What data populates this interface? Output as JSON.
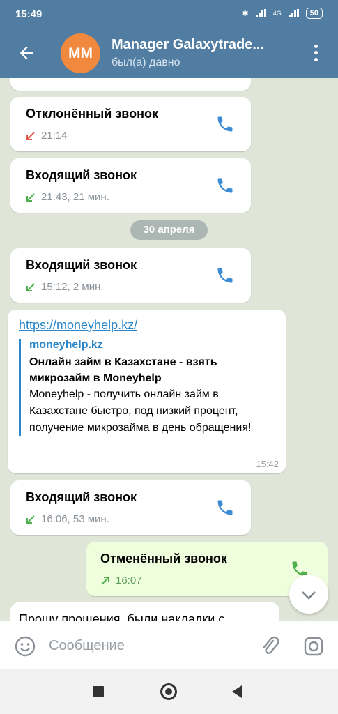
{
  "status_bar": {
    "time": "15:49",
    "battery": "50",
    "network": "4G"
  },
  "header": {
    "avatar_initials": "MM",
    "title": "Manager Galaxytrade...",
    "subtitle": "был(а) давно",
    "accent_color": "#517da2",
    "avatar_color": "#f0883d"
  },
  "messages": [
    {
      "type": "call",
      "title": "Отклонённый звонок",
      "meta": "21:14",
      "direction": "declined"
    },
    {
      "type": "call",
      "title": "Входящий звонок",
      "meta": "21:43, 21 мин.",
      "direction": "incoming"
    },
    {
      "type": "date",
      "label": "30 апреля"
    },
    {
      "type": "call",
      "title": "Входящий звонок",
      "meta": "15:12, 2 мин.",
      "direction": "incoming"
    },
    {
      "type": "link",
      "url": "https://moneyhelp.kz/",
      "preview_site": "moneyhelp.kz",
      "preview_title": "Онлайн займ в Казахстане - взять микрозайм в Moneyhelp",
      "preview_desc": "Moneyhelp - получить онлайн займ в Казахстане быстро, под низкий процент, получение микрозайма в день обращения!",
      "time": "15:42"
    },
    {
      "type": "call",
      "title": "Входящий звонок",
      "meta": "16:06, 53 мин.",
      "direction": "incoming"
    },
    {
      "type": "call",
      "title": "Отменённый звонок",
      "meta": "16:07",
      "direction": "outgoing"
    },
    {
      "type": "text",
      "text": "Прошу прощения, были накладки с"
    }
  ],
  "composer": {
    "placeholder": "Сообщение"
  },
  "icons": {
    "back": "arrow-left-icon",
    "menu": "more-vert-icon",
    "phone": "phone-icon",
    "emoji": "emoji-icon",
    "attach": "paperclip-icon",
    "camera": "camera-icon",
    "scroll": "chevron-down-icon"
  }
}
